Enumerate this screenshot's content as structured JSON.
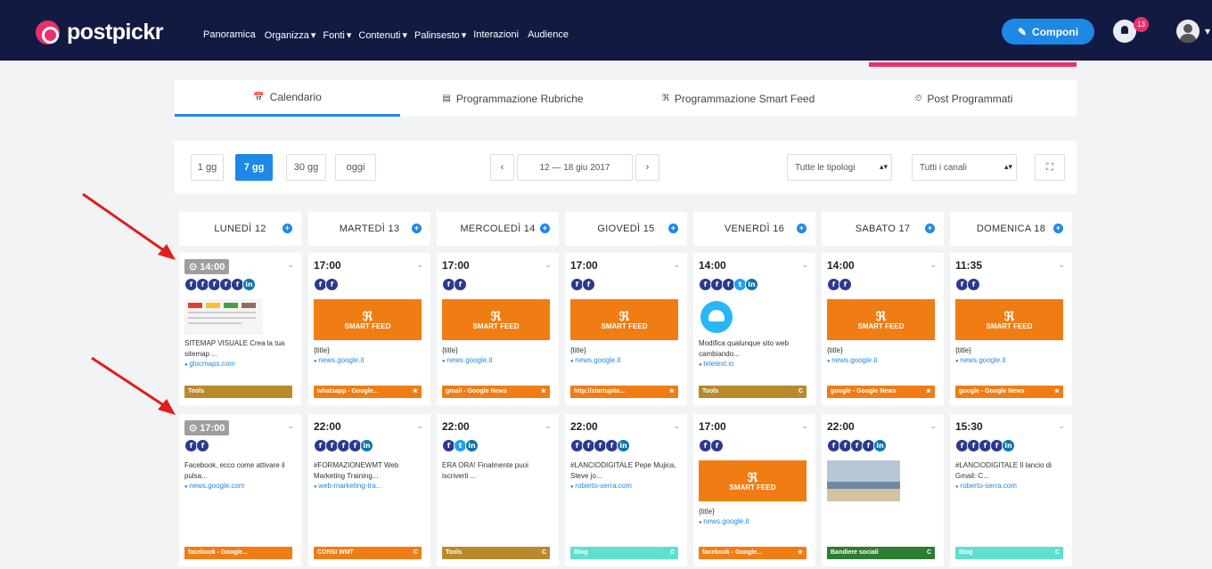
{
  "brand": {
    "name": "postpickr"
  },
  "nav": [
    "Panoramica",
    "Organizza",
    "Fonti",
    "Contenuti",
    "Palinsesto",
    "Interazioni",
    "Audience"
  ],
  "nav_dropdown": [
    "",
    "▾",
    "▾",
    "▾",
    "▾",
    "",
    ""
  ],
  "header": {
    "compose": "Componi",
    "notif_count": "13",
    "compose_icon": "pencil-icon"
  },
  "tabs": [
    {
      "icon": "📅",
      "label": "Calendario"
    },
    {
      "icon": "▤",
      "label": "Programmazione Rubriche"
    },
    {
      "icon": "ℜ",
      "label": "Programmazione Smart Feed"
    },
    {
      "icon": "⏲",
      "label": "Post Programmati"
    }
  ],
  "toolbar": {
    "r1": "1 gg",
    "r7": "7 gg",
    "r30": "30 gg",
    "today": "oggi",
    "prev": "‹",
    "range": "12 — 18 giu 2017",
    "next": "›",
    "filter1": "Tutte le tipologi",
    "filter2": "Tutti i canali",
    "expand": "⛶"
  },
  "days": [
    "LUNEDÌ 12",
    "MARTEDÌ 13",
    "MERCOLEDÌ 14",
    "GIOVEDÌ 15",
    "VENERDÌ 16",
    "SABATO 17",
    "DOMENICA 18"
  ],
  "smart_feed_label": "SMART FEED",
  "rows": [
    [
      {
        "time": "14:00",
        "icons": "fffffin",
        "desc": "SITEMAP VISUALE Crea la tua sitemap ...",
        "link": "glocmaps.com",
        "tag": "Tools",
        "tagcolor": "#b98a2c",
        "tagicon": ""
      },
      {
        "time": "17:00",
        "icons": "ff",
        "sf": true,
        "desc": "{title}",
        "link": "news.google.it",
        "tag": "whatsapp - Google...",
        "tagcolor": "#f07d14",
        "tagicon": "★"
      },
      {
        "time": "17:00",
        "icons": "ff",
        "sf": true,
        "desc": "{title}",
        "link": "news.google.it",
        "tag": "gmail - Google News",
        "tagcolor": "#f07d14",
        "tagicon": "★"
      },
      {
        "time": "17:00",
        "icons": "ff",
        "sf": true,
        "desc": "{title}",
        "link": "news.google.it",
        "tag": "http://startupita...",
        "tagcolor": "#f07d14",
        "tagicon": "★"
      },
      {
        "time": "14:00",
        "icons": "ffftin",
        "desc": "Modifica qualunque sito web cambiando...",
        "link": "teletext.io",
        "tag": "Tools",
        "tagcolor": "#b98a2c",
        "tagicon": "C"
      },
      {
        "time": "14:00",
        "icons": "ff",
        "sf": true,
        "desc": "{title}",
        "link": "news.google.it",
        "tag": "google - Google News",
        "tagcolor": "#f07d14",
        "tagicon": "★"
      },
      {
        "time": "11:35",
        "icons": "ff",
        "sf": true,
        "desc": "{title}",
        "link": "news.google.it",
        "tag": "google - Google News",
        "tagcolor": "#f07d14",
        "tagicon": "★"
      }
    ],
    [
      {
        "time": "17:00",
        "icons": "ff",
        "desc": "Facebook, ecco come attivare il pulsa...",
        "link": "news.google.com",
        "tag": "facebook - Google...",
        "tagcolor": "#f07d14",
        "tagicon": ""
      },
      {
        "time": "22:00",
        "icons": "ffffin",
        "desc": "#FORMAZIONEWMT Web Marketing Training...",
        "link": "web-marketing-tra...",
        "tag": "CORSI WMT",
        "tagcolor": "#f07d14",
        "tagicon": "C"
      },
      {
        "time": "22:00",
        "icons": "ftin",
        "desc": "ERA ORA! Finalmente puoi iscriverti ...",
        "link": "",
        "tag": "Tools",
        "tagcolor": "#b98a2c",
        "tagicon": "C"
      },
      {
        "time": "22:00",
        "icons": "ffffin",
        "desc": "#LANCIODIGITALE Pepe Mujica, Steve jo...",
        "link": "roberto-serra.com",
        "tag": "Blog",
        "tagcolor": "#5ee0cf",
        "tagicon": "C"
      },
      {
        "time": "17:00",
        "icons": "ff",
        "sf": true,
        "desc": "{title}",
        "link": "news.google.it",
        "tag": "facebook - Google...",
        "tagcolor": "#f07d14",
        "tagicon": "★"
      },
      {
        "time": "22:00",
        "icons": "ffffin",
        "desc": "",
        "link": "",
        "tag": "Bandiere sociali",
        "tagcolor": "#2e7d32",
        "tagicon": "C"
      },
      {
        "time": "15:30",
        "icons": "ffffin",
        "desc": "#LANCIODIGITALE Il lancio di Gmail: C...",
        "link": "roberto-serra.com",
        "tag": "Blog",
        "tagcolor": "#5ee0cf",
        "tagicon": "C"
      }
    ]
  ]
}
